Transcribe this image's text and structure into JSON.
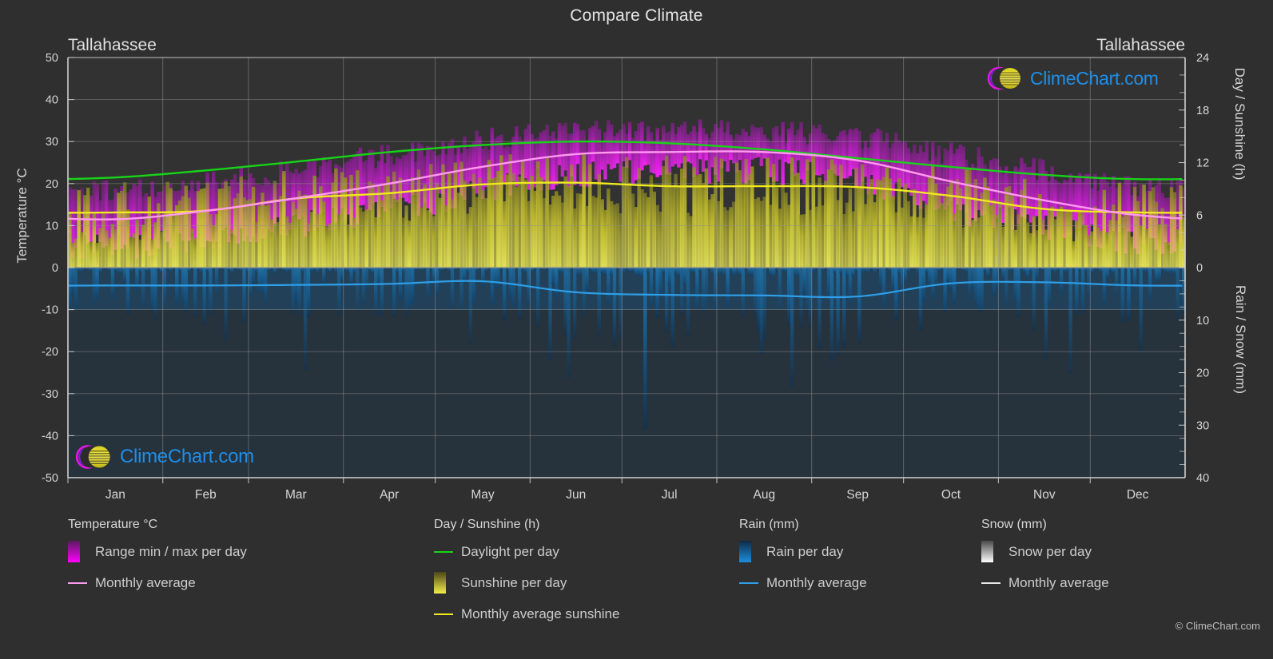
{
  "header": {
    "title": "Compare Climate",
    "city_left": "Tallahassee",
    "city_right": "Tallahassee"
  },
  "axes": {
    "left_title": "Temperature °C",
    "right_title_top": "Day / Sunshine (h)",
    "right_title_bottom": "Rain / Snow (mm)",
    "left_ticks": [
      "50",
      "40",
      "30",
      "20",
      "10",
      "0",
      "-10",
      "-20",
      "-30",
      "-40",
      "-50"
    ],
    "right_ticks_top": [
      "24",
      "18",
      "12",
      "6",
      "0"
    ],
    "right_ticks_bottom": [
      "10",
      "20",
      "30",
      "40"
    ],
    "months": [
      "Jan",
      "Feb",
      "Mar",
      "Apr",
      "May",
      "Jun",
      "Jul",
      "Aug",
      "Sep",
      "Oct",
      "Nov",
      "Dec"
    ]
  },
  "logo": {
    "text": "ClimeChart.com"
  },
  "legend": {
    "groups": [
      {
        "title": "Temperature °C",
        "items": [
          {
            "label": "Range min / max per day",
            "marker": "gradient-box",
            "color": "#ff00ff",
            "color2": "#5a1a5e"
          },
          {
            "label": "Monthly average",
            "marker": "line",
            "color": "#ff9aee"
          }
        ]
      },
      {
        "title": "Day / Sunshine (h)",
        "items": [
          {
            "label": "Daylight per day",
            "marker": "line",
            "color": "#17d417"
          },
          {
            "label": "Sunshine per day",
            "marker": "gradient-box",
            "color": "#f2ef4a",
            "color2": "#4c4617"
          },
          {
            "label": "Monthly average sunshine",
            "marker": "line",
            "color": "#efe91f"
          }
        ]
      },
      {
        "title": "Rain (mm)",
        "items": [
          {
            "label": "Rain per day",
            "marker": "gradient-box",
            "color": "#1a8fe0",
            "color2": "#102a46"
          },
          {
            "label": "Monthly average",
            "marker": "line",
            "color": "#2e9fe8"
          }
        ]
      },
      {
        "title": "Snow (mm)",
        "items": [
          {
            "label": "Snow per day",
            "marker": "gradient-box",
            "color": "#ffffff",
            "color2": "#4a4a4a"
          },
          {
            "label": "Monthly average",
            "marker": "line",
            "color": "#e8e8e8"
          }
        ]
      }
    ],
    "copyright": "© ClimeChart.com"
  },
  "colors": {
    "background": "#2f2f2f",
    "grid": "#8e8e8e",
    "axis": "#cfcfcf",
    "text": "#d6d6d6",
    "temp_range": "#ff00ff",
    "temp_avg": "#ff9aee",
    "daylight": "#17d417",
    "sunshine": "#d7d432",
    "sunshine_avg": "#efe91f",
    "rain": "#1a8fe0",
    "rain_avg": "#2e9fe8",
    "snow": "#ffffff",
    "logo_blue": "#1f8fe8",
    "logo_magenta": "#e018e0",
    "logo_yellow": "#e0d820"
  },
  "chart_data": {
    "type": "area",
    "title": "Compare Climate",
    "subtitle": "Tallahassee",
    "xlabel": "",
    "ylabel": "Temperature °C",
    "ylabel_right_top": "Day / Sunshine (h)",
    "ylabel_right_bottom": "Rain / Snow (mm)",
    "ylim": [
      -50,
      50
    ],
    "ylim_right_top": [
      0,
      24
    ],
    "ylim_right_bottom": [
      0,
      40
    ],
    "grid": true,
    "legend_position": "below",
    "categories": [
      "Jan",
      "Feb",
      "Mar",
      "Apr",
      "May",
      "Jun",
      "Jul",
      "Aug",
      "Sep",
      "Oct",
      "Nov",
      "Dec"
    ],
    "series": [
      {
        "name": "Monthly average temperature (°C)",
        "color": "#ff9aee",
        "unit": "°C",
        "values": [
          11.5,
          13.5,
          16.5,
          20.0,
          24.0,
          27.0,
          27.5,
          27.5,
          25.5,
          20.5,
          16.0,
          12.5
        ]
      },
      {
        "name": "Monthly average daily maximum (°C)",
        "color": "#ff00ff",
        "unit": "°C",
        "values": [
          18.0,
          20.0,
          23.5,
          27.0,
          30.5,
          32.5,
          32.5,
          32.5,
          31.0,
          27.0,
          23.0,
          19.0
        ]
      },
      {
        "name": "Monthly average daily minimum (°C)",
        "color": "#a020a0",
        "unit": "°C",
        "values": [
          5.0,
          7.0,
          10.0,
          13.5,
          18.5,
          22.0,
          23.0,
          23.0,
          20.5,
          14.0,
          9.5,
          6.0
        ]
      },
      {
        "name": "Daylight per day (h)",
        "color": "#17d417",
        "unit": "h",
        "values": [
          10.3,
          11.1,
          12.1,
          13.2,
          14.0,
          14.4,
          14.2,
          13.5,
          12.5,
          11.5,
          10.6,
          10.1
        ]
      },
      {
        "name": "Monthly average sunshine (h)",
        "color": "#efe91f",
        "unit": "h",
        "values": [
          6.3,
          6.5,
          7.9,
          8.5,
          9.5,
          9.7,
          9.3,
          9.3,
          9.2,
          8.2,
          6.7,
          6.3
        ]
      },
      {
        "name": "Monthly average rain (mm)",
        "color": "#2e9fe8",
        "unit": "mm",
        "values": [
          3.4,
          3.4,
          3.3,
          3.1,
          2.6,
          4.7,
          5.2,
          5.3,
          5.5,
          3.0,
          2.8,
          3.4
        ]
      },
      {
        "name": "Monthly average snow (mm)",
        "color": "#ffffff",
        "unit": "mm",
        "values": [
          0,
          0,
          0,
          0,
          0,
          0,
          0,
          0,
          0,
          0,
          0,
          0
        ]
      }
    ],
    "daily_bands": {
      "description": "Per-day vertical bars: magenta = daily temperature min/max range, yellow = daily sunshine hours, blue = daily rain (plotted downward)",
      "temp_range_color": "#ff00ff",
      "sunshine_color": "#d7d432",
      "rain_color": "#1a8fe0"
    }
  }
}
